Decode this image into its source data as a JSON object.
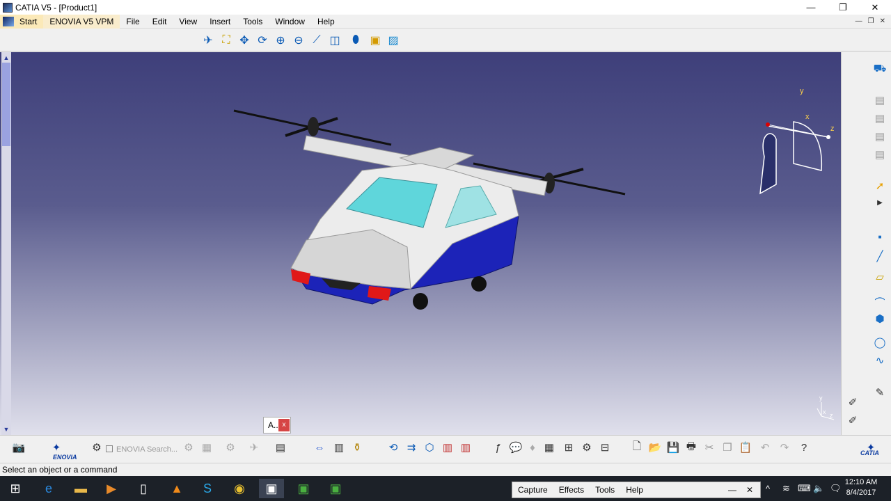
{
  "window": {
    "title": "CATIA V5 - [Product1]",
    "minimize": "—",
    "restore": "❐",
    "close": "✕"
  },
  "menu": {
    "start": "Start",
    "enovia": "ENOVIA V5 VPM",
    "items": [
      "File",
      "Edit",
      "View",
      "Insert",
      "Tools",
      "Window",
      "Help"
    ]
  },
  "mdi": {
    "minimize": "—",
    "restore": "❐",
    "close": "✕"
  },
  "toolbar_top": [
    "fly-icon",
    "fit-all-icon",
    "pan-icon",
    "rotate-icon",
    "zoom-in-icon",
    "zoom-out-icon",
    "normal-view-icon",
    "iso-view-icon",
    "shading-icon",
    "hide-show-icon",
    "swap-visible-icon"
  ],
  "axes": {
    "x": "x",
    "y": "y",
    "z": "z"
  },
  "mini_axes": {
    "x": "x",
    "y": "y",
    "z": "z"
  },
  "popup": {
    "label": "A..",
    "close": "x"
  },
  "bottom": {
    "enovia_logo": "ENOVIA",
    "enovia_search": "ENOVIA Search...",
    "catia_logo": "CATIA"
  },
  "status": {
    "message": "Select an object or a command"
  },
  "capture": {
    "items": [
      "Capture",
      "Effects",
      "Tools",
      "Help"
    ],
    "minimize": "—",
    "close": "✕"
  },
  "clock": {
    "time": "12:10 AM",
    "date": "8/4/2017"
  }
}
